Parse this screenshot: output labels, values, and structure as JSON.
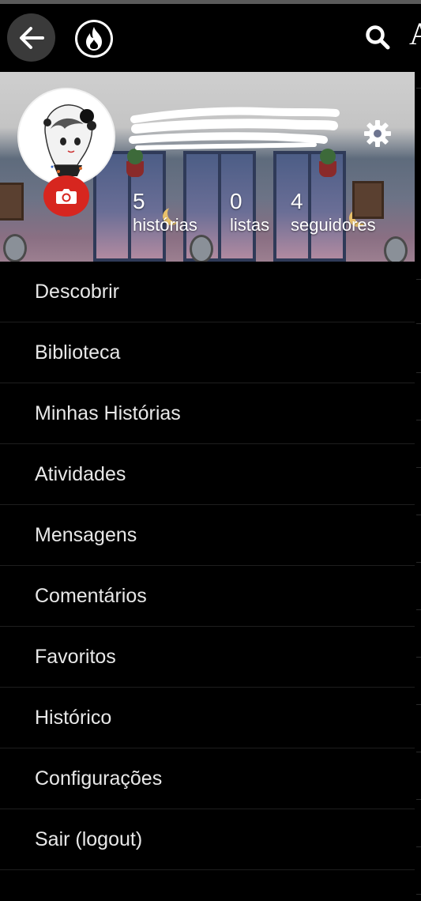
{
  "topbar": {
    "back_icon": "arrow-left-icon",
    "logo_icon": "flame-icon",
    "search_icon": "search-icon",
    "cut_text": "A"
  },
  "profile": {
    "avatar_icon": "anime-avatar",
    "camera_icon": "camera-icon",
    "settings_icon": "gear-icon",
    "stats": [
      {
        "value": "5",
        "label": "histórias"
      },
      {
        "value": "0",
        "label": "listas"
      },
      {
        "value": "4",
        "label": "seguidores"
      }
    ]
  },
  "menu": {
    "items": [
      {
        "label": "Descobrir"
      },
      {
        "label": "Biblioteca"
      },
      {
        "label": "Minhas Histórias"
      },
      {
        "label": "Atividades"
      },
      {
        "label": "Mensagens"
      },
      {
        "label": "Comentários"
      },
      {
        "label": "Favoritos"
      },
      {
        "label": "Histórico"
      },
      {
        "label": "Configurações"
      },
      {
        "label": "Sair (logout)"
      }
    ]
  },
  "colors": {
    "background": "#000000",
    "text": "#e8e8e8",
    "camera_button": "#d7261f",
    "back_button": "#3a3a3a"
  }
}
